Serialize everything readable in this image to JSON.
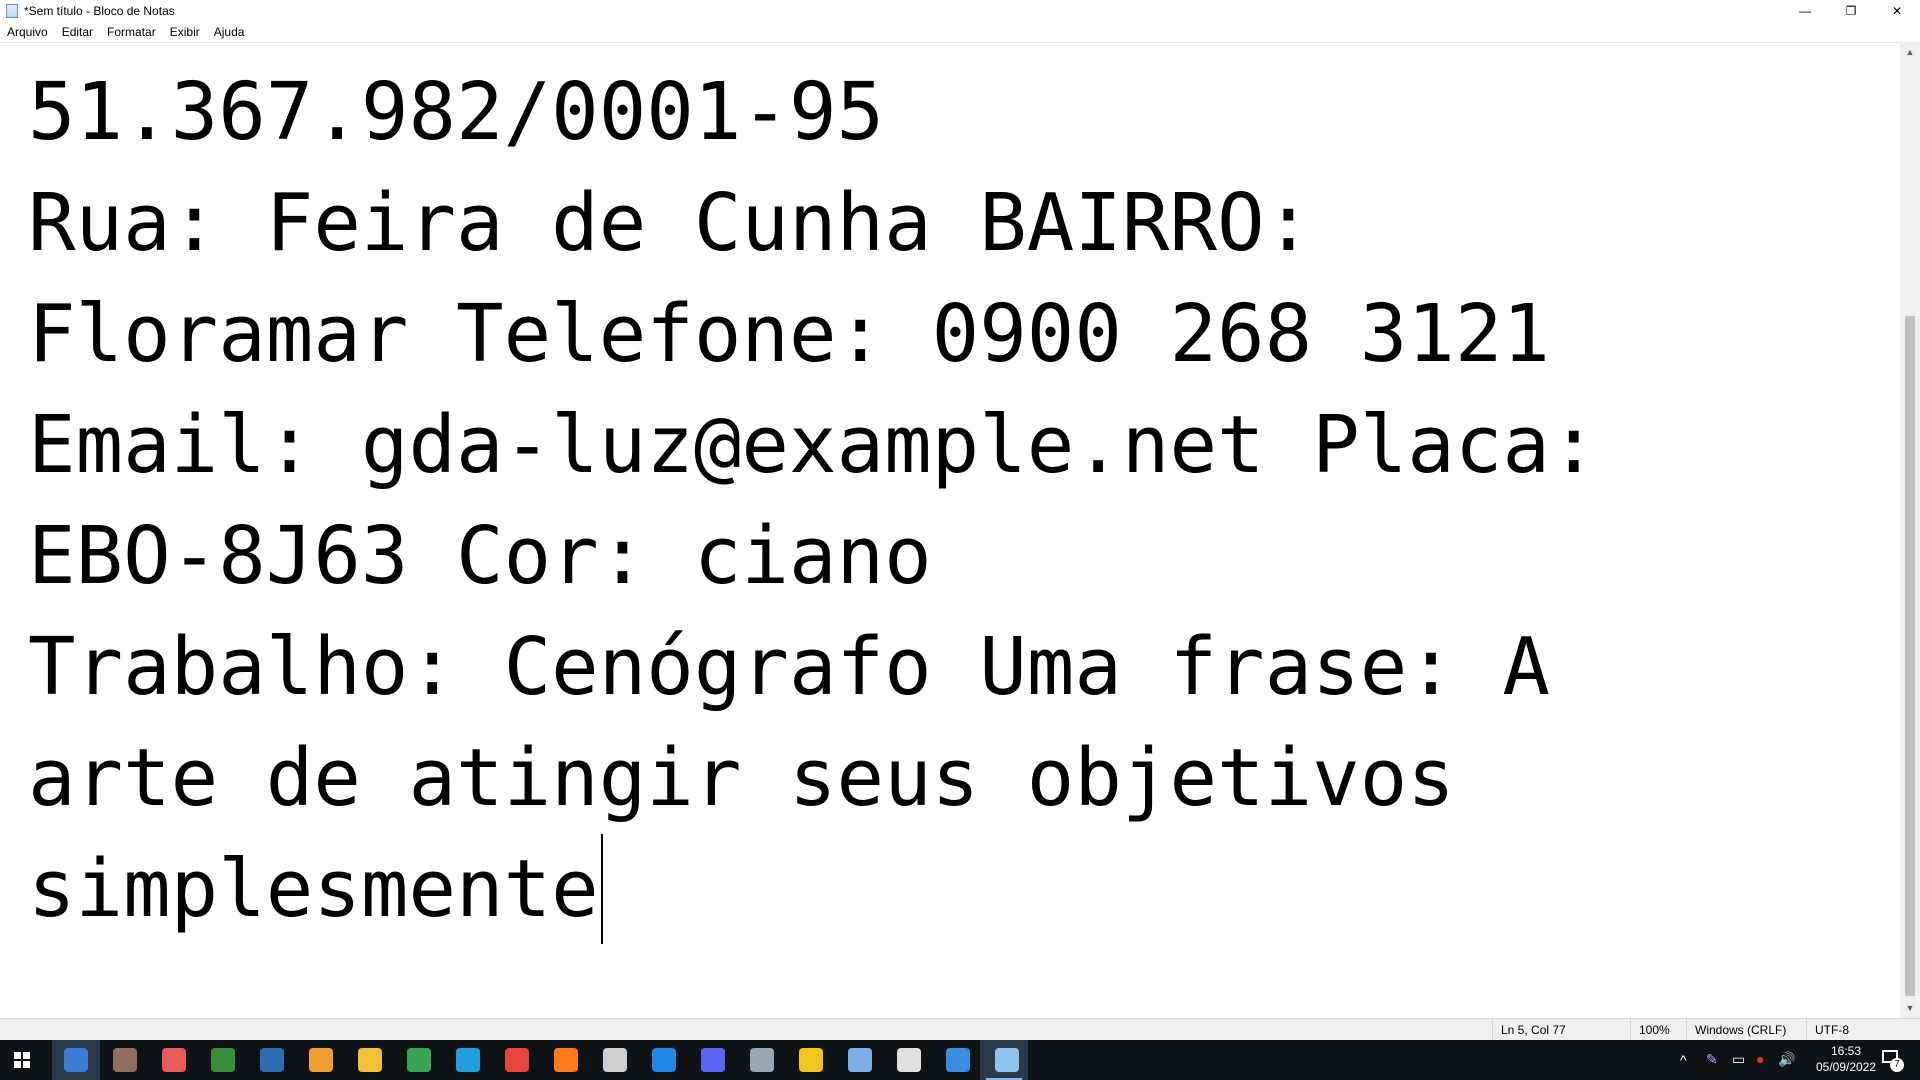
{
  "window": {
    "title": "*Sem título - Bloco de Notas",
    "minimize_glyph": "—",
    "maximize_glyph": "❐",
    "close_glyph": "✕"
  },
  "menu": [
    "Arquivo",
    "Editar",
    "Formatar",
    "Exibir",
    "Ajuda"
  ],
  "editor": {
    "lines": [
      "51.367.982/0001-95",
      "Rua: Feira de Cunha BAIRRO:",
      "Floramar Telefone: 0900 268 3121",
      "Email: gda-luz@example.net Placa:",
      "EBO-8J63 Cor: ciano",
      "Trabalho: Cenógrafo Uma frase: A",
      "arte de atingir seus objetivos",
      "simplesmente"
    ]
  },
  "scrollbar": {
    "up_glyph": "▲",
    "down_glyph": "▼"
  },
  "status": {
    "position": "Ln 5, Col 77",
    "zoom": "100%",
    "line_ending": "Windows (CRLF)",
    "encoding": "UTF-8"
  },
  "taskbar": {
    "icons": [
      {
        "name": "search-icon",
        "color": "#3a7bd5"
      },
      {
        "name": "person-icon",
        "color": "#8f6f5a"
      },
      {
        "name": "paint-icon",
        "color": "#e65a5a"
      },
      {
        "name": "hs-icon",
        "color": "#3b8f3b"
      },
      {
        "name": "code-tool-icon",
        "color": "#2f6cb3"
      },
      {
        "name": "binoculars-icon",
        "color": "#f0a030"
      },
      {
        "name": "folder-icon",
        "color": "#f2c037"
      },
      {
        "name": "notepad-green-icon",
        "color": "#3aa655"
      },
      {
        "name": "edge-icon",
        "color": "#1fa0e0"
      },
      {
        "name": "chrome-icon",
        "color": "#e8453c"
      },
      {
        "name": "firefox-icon",
        "color": "#ff7a1a"
      },
      {
        "name": "calendar-icon",
        "color": "#d0d0d0"
      },
      {
        "name": "vscode-icon",
        "color": "#1e88e5"
      },
      {
        "name": "discord-icon",
        "color": "#5865f2"
      },
      {
        "name": "monitor-icon",
        "color": "#9aa5b1"
      },
      {
        "name": "headset-icon",
        "color": "#f3c51a"
      },
      {
        "name": "paintbrush-icon",
        "color": "#7fb2e5"
      },
      {
        "name": "gear-icon",
        "color": "#e0e0e0"
      },
      {
        "name": "photo-icon",
        "color": "#3c8de0"
      },
      {
        "name": "notepad-icon",
        "color": "#8fc3f0"
      }
    ],
    "tray": {
      "time": "16:53",
      "date": "05/09/2022",
      "notification_count": "7"
    }
  }
}
